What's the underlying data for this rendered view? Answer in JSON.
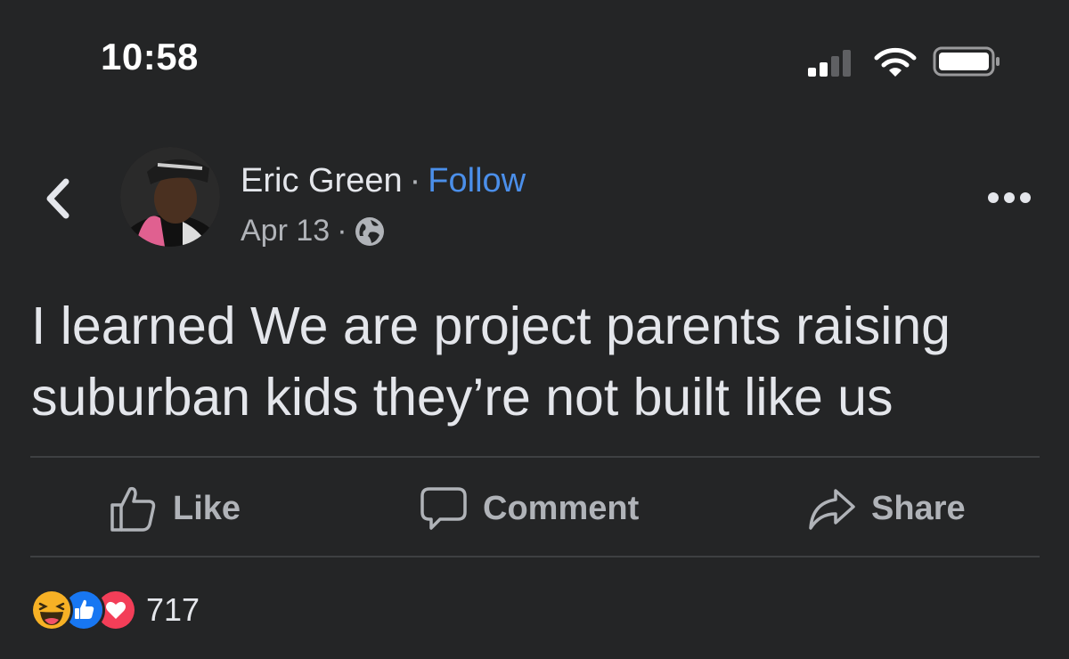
{
  "status_bar": {
    "time": "10:58",
    "icons": [
      "signal-icon",
      "wifi-icon",
      "battery-icon"
    ]
  },
  "post": {
    "author": "Eric Green",
    "separator": "·",
    "follow_label": "Follow",
    "date": "Apr 13",
    "meta_separator": "·",
    "privacy_icon": "globe-icon",
    "text": "I learned We are project parents raising suburban kids they’re not built like us"
  },
  "actions": {
    "like": "Like",
    "comment": "Comment",
    "share": "Share"
  },
  "reactions": {
    "types": [
      "haha",
      "like",
      "love"
    ],
    "count": "717"
  },
  "colors": {
    "background": "#242526",
    "text_primary": "#e4e6eb",
    "text_secondary": "#b0b3b8",
    "link_blue": "#4b8fea",
    "divider": "#3e4042",
    "like_blue": "#1877f2",
    "love_red": "#f33e58",
    "haha_yellow": "#f7b125"
  }
}
